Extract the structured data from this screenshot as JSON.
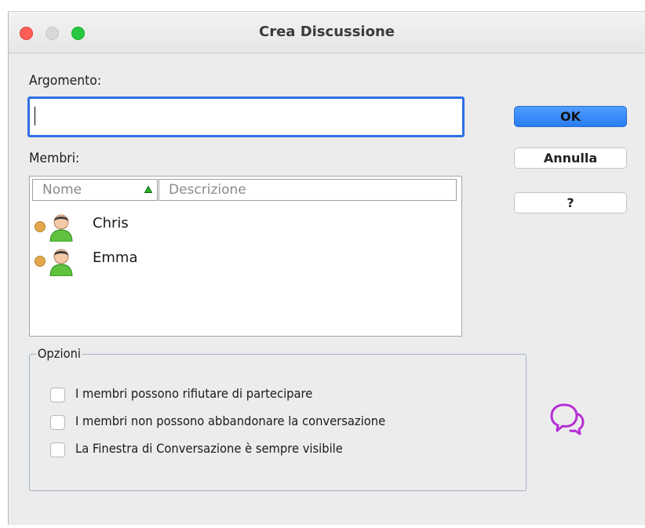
{
  "window": {
    "title": "Crea Discussione"
  },
  "topic": {
    "label": "Argomento:",
    "value": ""
  },
  "members": {
    "label": "Membri:",
    "columns": {
      "name": "Nome",
      "description": "Descrizione"
    },
    "rows": [
      {
        "name": "Chris"
      },
      {
        "name": "Emma"
      }
    ]
  },
  "buttons": {
    "ok": "OK",
    "cancel": "Annulla",
    "help": "?"
  },
  "options": {
    "legend": "Opzioni",
    "items": [
      {
        "label": "I membri possono rifiutare di partecipare",
        "checked": false
      },
      {
        "label": "I membri non possono abbandonare la conversazione",
        "checked": false
      },
      {
        "label": "La Finestra di Conversazione è sempre visibile",
        "checked": false
      }
    ]
  },
  "colors": {
    "accent": "#2a7cf0",
    "status_away": "#e4a84a",
    "chat_icon": "#b62fd6",
    "sort_arrow": "#27b427"
  },
  "icons": [
    "close-icon",
    "minimize-icon",
    "maximize-icon",
    "sort-ascending-icon",
    "user-avatar-icon",
    "status-dot-icon",
    "chat-bubbles-icon"
  ]
}
